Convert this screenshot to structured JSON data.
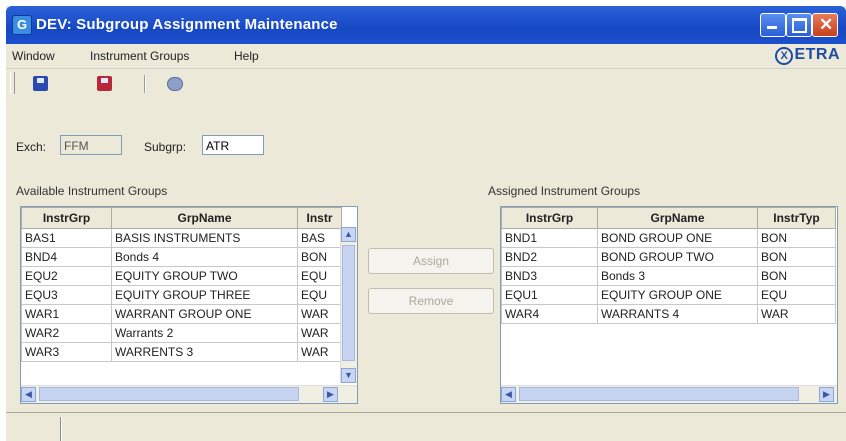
{
  "window": {
    "title": "DEV: Subgroup Assignment Maintenance",
    "app_icon_letter": "G"
  },
  "menu": {
    "items": [
      "Window",
      "Instrument Groups",
      "Help"
    ],
    "logo_text": "ETRA",
    "logo_mark": "X"
  },
  "toolbar": {
    "icons": [
      "save-icon",
      "save-red-icon",
      "print-icon"
    ]
  },
  "filters": {
    "exch_label": "Exch:",
    "exch_value": "FFM",
    "subgrp_label": "Subgrp:",
    "subgrp_value": "ATR"
  },
  "available": {
    "label": "Available Instrument Groups",
    "columns": [
      "InstrGrp",
      "GrpName",
      "Instr"
    ],
    "rows": [
      [
        "BAS1",
        "BASIS INSTRUMENTS",
        "BAS"
      ],
      [
        "BND4",
        "Bonds 4",
        "BON"
      ],
      [
        "EQU2",
        "EQUITY GROUP TWO",
        "EQU"
      ],
      [
        "EQU3",
        "EQUITY GROUP THREE",
        "EQU"
      ],
      [
        "WAR1",
        "WARRANT GROUP ONE",
        "WAR"
      ],
      [
        "WAR2",
        "Warrants 2",
        "WAR"
      ],
      [
        "WAR3",
        "WARRENTS 3",
        "WAR"
      ]
    ]
  },
  "actions": {
    "assign_label": "Assign",
    "remove_label": "Remove"
  },
  "assigned": {
    "label": "Assigned Instrument Groups",
    "columns": [
      "InstrGrp",
      "GrpName",
      "InstrTyp"
    ],
    "rows": [
      [
        "BND1",
        "BOND GROUP ONE",
        "BON"
      ],
      [
        "BND2",
        "BOND GROUP TWO",
        "BON"
      ],
      [
        "BND3",
        "Bonds 3",
        "BON"
      ],
      [
        "EQU1",
        "EQUITY GROUP ONE",
        "EQU"
      ],
      [
        "WAR4",
        "WARRANTS 4",
        "WAR"
      ]
    ]
  },
  "scroll_glyphs": {
    "up": "▲",
    "down": "▼",
    "left": "◀",
    "right": "▶"
  }
}
